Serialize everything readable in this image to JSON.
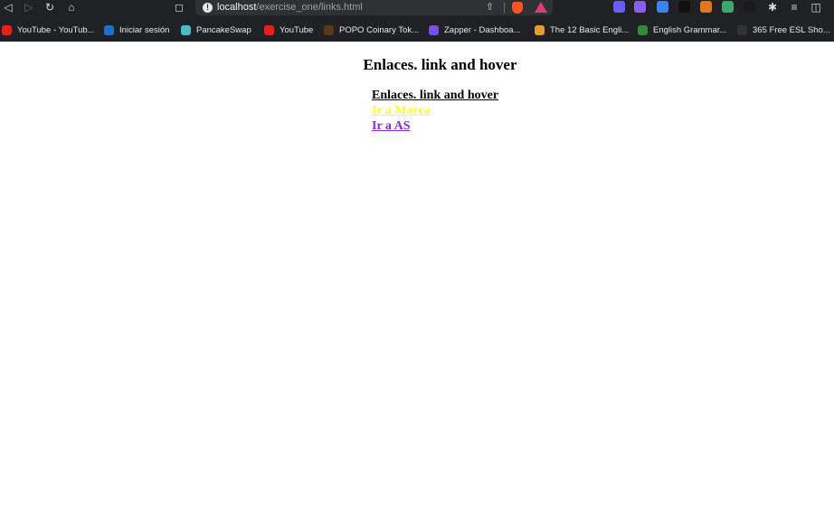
{
  "browser": {
    "url_host": "localhost",
    "url_path": "/exercise_one/links.html",
    "bookmarks": [
      {
        "label": "YouTube - YouTub...",
        "color": "#e62117"
      },
      {
        "label": "Iniciar sesión",
        "color": "#1a73c9"
      },
      {
        "label": "PancakeSwap",
        "color": "#4fb8c4"
      },
      {
        "label": "YouTube",
        "color": "#e62117"
      },
      {
        "label": "POPO Coinary Tok...",
        "color": "#5a3a12"
      },
      {
        "label": "Zapper - Dashboa...",
        "color": "#7a4fe8"
      },
      {
        "label": "The 12 Basic Engli...",
        "color": "#e0a030"
      },
      {
        "label": "English Grammar...",
        "color": "#2e8b3a"
      },
      {
        "label": "365 Free ESL Sho...",
        "color": "#333333"
      }
    ],
    "extensions": [
      {
        "icon": "sparkle-extension-icon",
        "color": "#6b5cf5"
      },
      {
        "icon": "bookmark-extension-icon",
        "color": "#8b5cf6"
      },
      {
        "icon": "drop-extension-icon",
        "color": "#3b82f6"
      },
      {
        "icon": "dots-extension-icon",
        "color": "#111111"
      },
      {
        "icon": "fox-extension-icon",
        "color": "#e2761b"
      },
      {
        "icon": "wallet-extension-icon",
        "color": "#3aa76d"
      },
      {
        "icon": "diamond-extension-icon",
        "color": "#1b1b1b"
      }
    ]
  },
  "page": {
    "title": "Enlaces. link and hover",
    "links": [
      {
        "label": "Enlaces. link and hover",
        "color": "#000000"
      },
      {
        "label": "Ir a Marca",
        "color": "#ffff33"
      },
      {
        "label": "Ir a AS",
        "color": "#8a2be2"
      }
    ]
  }
}
